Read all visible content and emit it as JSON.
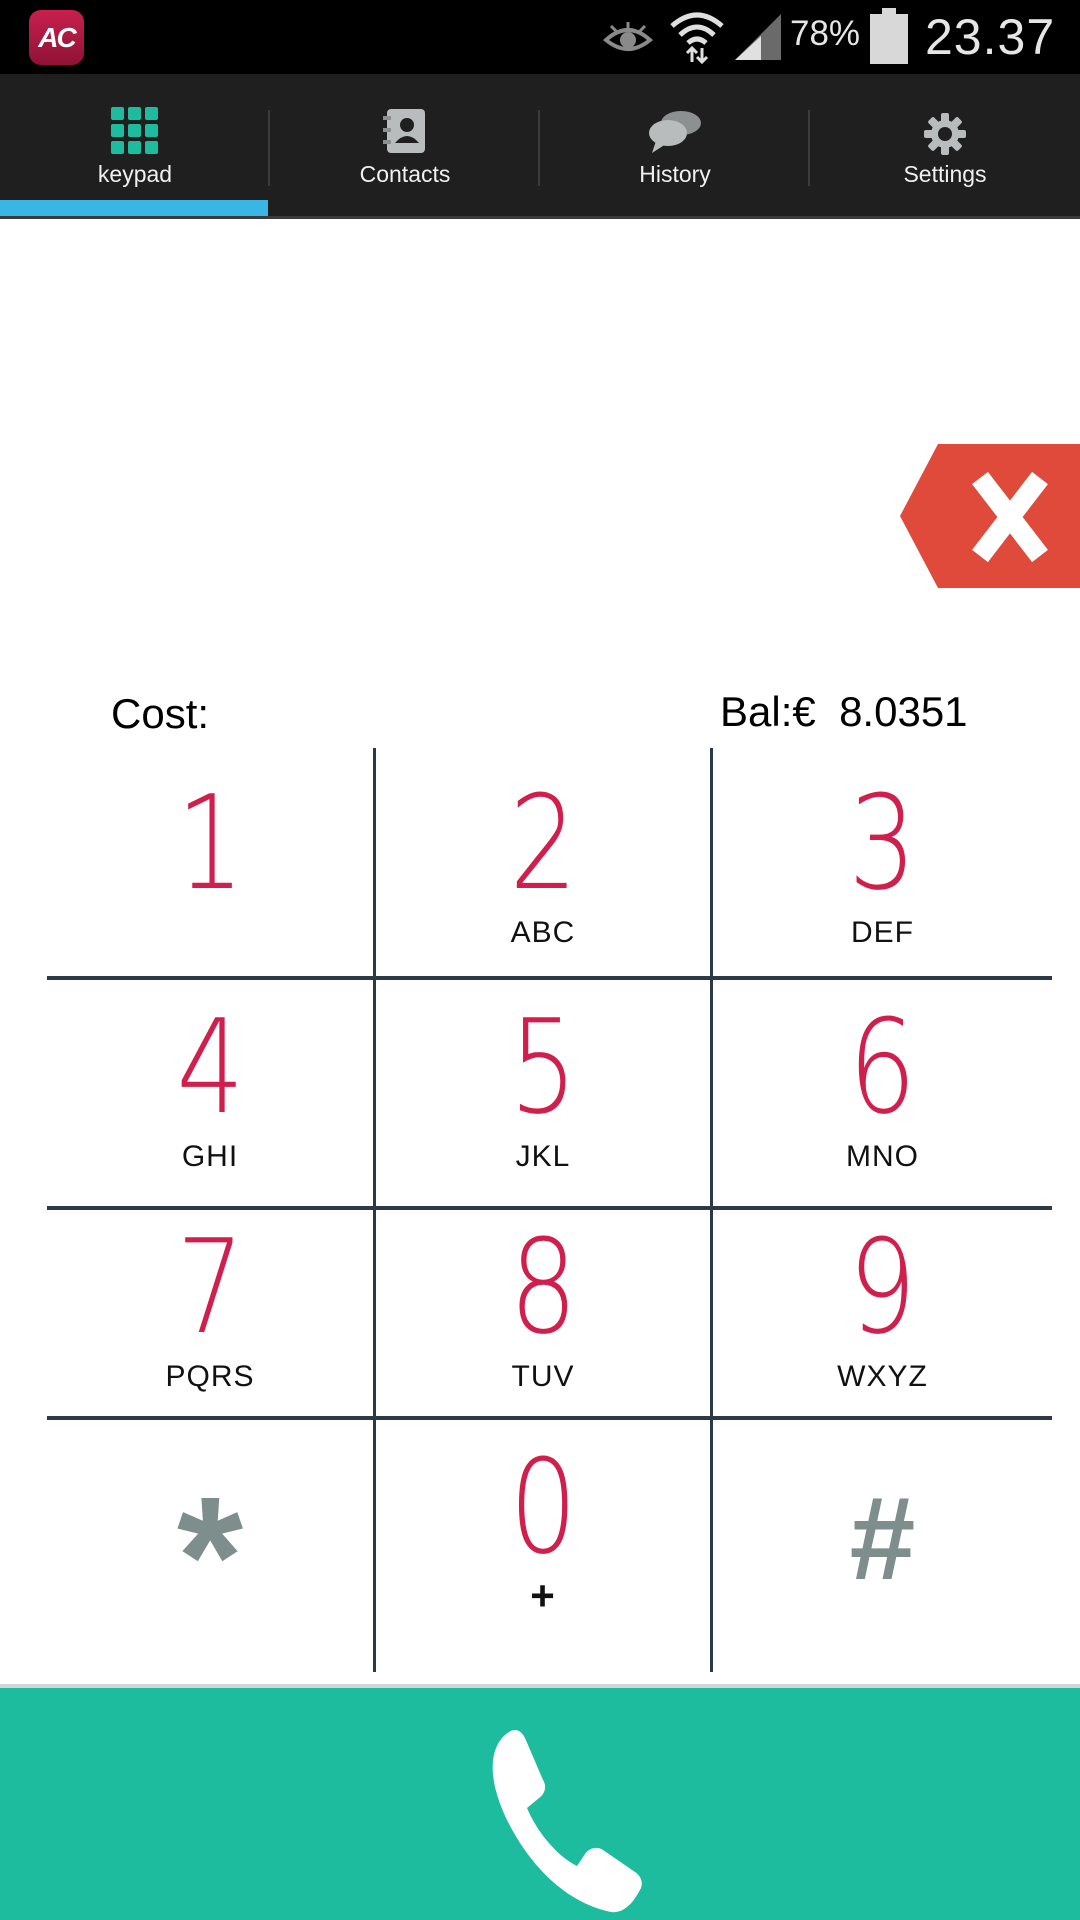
{
  "status_bar": {
    "app_icon_text": "AC",
    "battery_percent": "78%",
    "time": "23.37"
  },
  "tabs": [
    {
      "label": "keypad",
      "icon": "keypad-grid-icon",
      "active": true
    },
    {
      "label": "Contacts",
      "icon": "contacts-book-icon",
      "active": false
    },
    {
      "label": "History",
      "icon": "chat-bubbles-icon",
      "active": false
    },
    {
      "label": "Settings",
      "icon": "gear-icon",
      "active": false
    }
  ],
  "dial": {
    "number": "",
    "cost_label": "Cost:",
    "balance_label": "Bal:€  8.0351"
  },
  "keypad": {
    "keys": [
      {
        "digit": "1",
        "letters": ""
      },
      {
        "digit": "2",
        "letters": "ABC"
      },
      {
        "digit": "3",
        "letters": "DEF"
      },
      {
        "digit": "4",
        "letters": "GHI"
      },
      {
        "digit": "5",
        "letters": "JKL"
      },
      {
        "digit": "6",
        "letters": "MNO"
      },
      {
        "digit": "7",
        "letters": "PQRS"
      },
      {
        "digit": "8",
        "letters": "TUV"
      },
      {
        "digit": "9",
        "letters": "WXYZ"
      },
      {
        "digit": "*",
        "letters": ""
      },
      {
        "digit": "0",
        "letters": "+"
      },
      {
        "digit": "#",
        "letters": ""
      }
    ]
  },
  "colors": {
    "digit": "#d11f4d",
    "symbol": "#7d8e8c",
    "call_bar": "#1dbc9e",
    "tab_indicator": "#39b5e6",
    "delete": "#e04a3a"
  }
}
